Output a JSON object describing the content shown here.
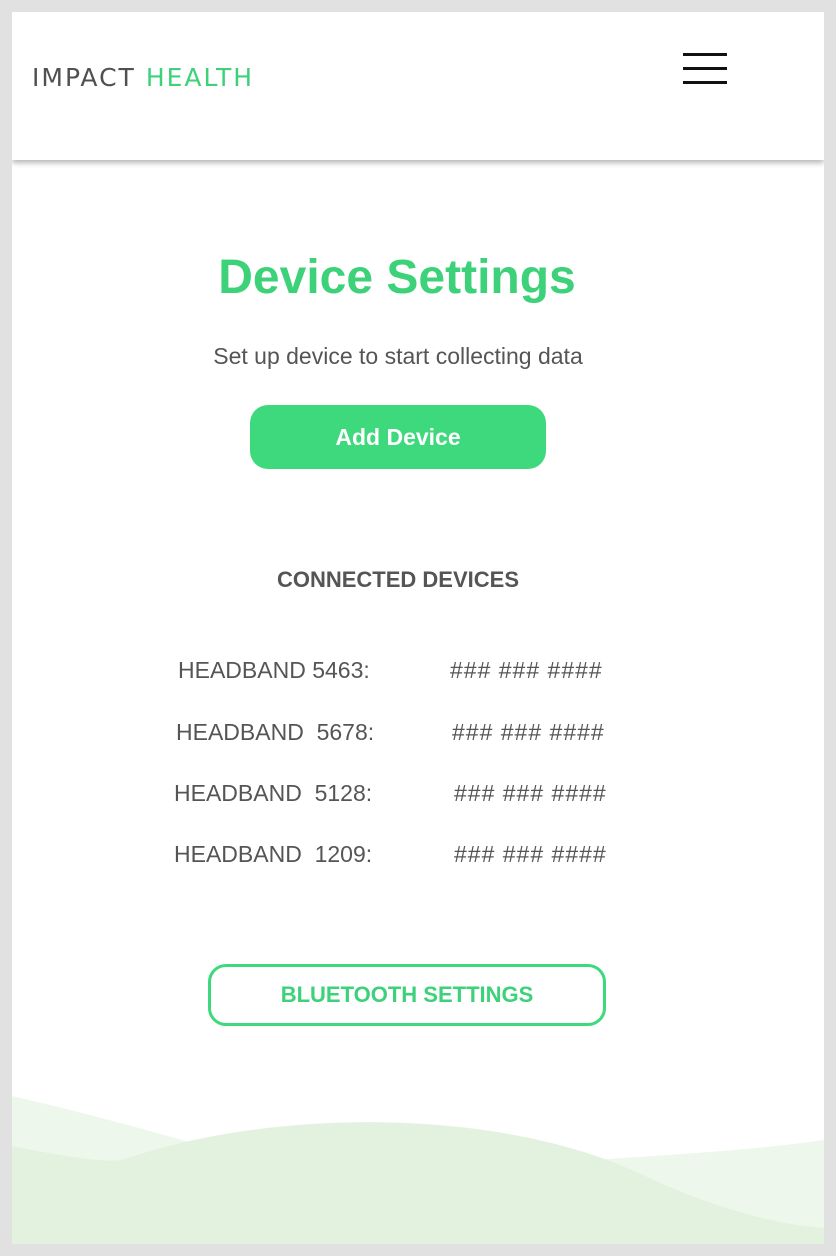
{
  "header": {
    "logo_word_1": "IMPACT",
    "logo_word_2": "HEALTH",
    "menu_icon": "hamburger-menu-icon"
  },
  "main": {
    "title": "Device Settings",
    "subtitle": "Set up device to start collecting data",
    "add_device_label": "Add Device",
    "section_title": "CONNECTED DEVICES",
    "devices": [
      {
        "name": "HEADBAND 5463:",
        "value": "### ### ####"
      },
      {
        "name": "HEADBAND  5678:",
        "value": "### ### ####"
      },
      {
        "name": "HEADBAND  5128:",
        "value": "### ### ####"
      },
      {
        "name": "HEADBAND  1209:",
        "value": "### ### ####"
      }
    ],
    "bluetooth_label": "BLUETOOTH SETTINGS"
  },
  "colors": {
    "accent": "#3dd97c",
    "text_gray": "#555555",
    "wave_light": "#e6f4e3",
    "frame": "#e1e1e1"
  }
}
